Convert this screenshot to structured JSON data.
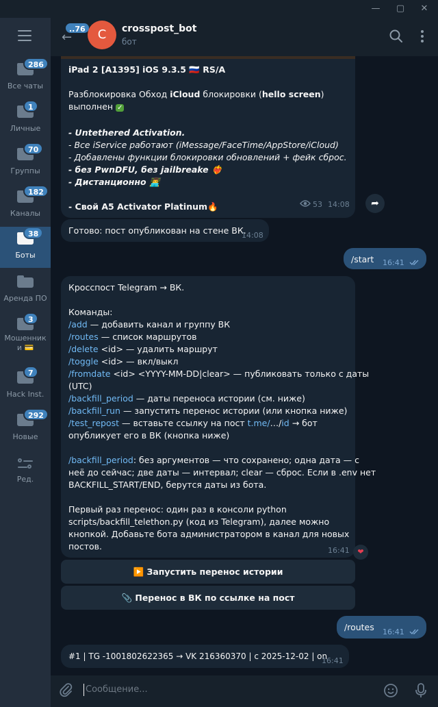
{
  "window": {
    "minimize": "—",
    "maximize": "▢",
    "close": "✕"
  },
  "sidebar": {
    "folders": [
      {
        "label": "Все чаты",
        "badge": "286"
      },
      {
        "label": "Личные",
        "badge": "1"
      },
      {
        "label": "Группы",
        "badge": "70"
      },
      {
        "label": "Каналы",
        "badge": "182"
      },
      {
        "label": "Боты",
        "badge": "38"
      },
      {
        "label": "Аренда ПО",
        "badge": ""
      },
      {
        "label": "Мошенник и 💳",
        "badge": "3"
      },
      {
        "label": "Hack Inst.",
        "badge": "7"
      },
      {
        "label": "Новые",
        "badge": "292"
      }
    ],
    "edit_label": "Ред."
  },
  "header": {
    "unread": "..76",
    "avatar_letter": "C",
    "title": "crosspost_bot",
    "status": "бот"
  },
  "messages": {
    "post": {
      "line1": "iPad 2 [A1395] iOS 9.3.5 🇷🇺 RS/A",
      "line2a": "Разблокировка Обход ",
      "line2b": "iCloud",
      "line2c": " блокировки (",
      "line2d": "hello screen",
      "line2e": ")",
      "line3": "выполнен",
      "line3_check": "✓",
      "line4": "- Untethered Activation.",
      "line5": "- Все iService работают (iMessage/FaceTime/AppStore/iCloud)",
      "line6": "- Добавлены функции блокировки обновлений + фейк сброс.",
      "line7": "- без PwnDFU, без jailbreake ❤️‍🔥",
      "line8": "- Дистанционно 👨‍💻",
      "line9": "- Свой A5 Activator Platinum🔥",
      "views": "53",
      "time": "14:08"
    },
    "published": {
      "text": "Готово: пост опубликован на стене ВК.",
      "time": "14:08"
    },
    "start_cmd": {
      "text": "/start",
      "time": "16:41"
    },
    "help": {
      "l1": "Кросспост Telegram → ВК.",
      "l2": "Команды:",
      "l3_cmd": "/add",
      "l3_rest": " — добавить канал и группу ВК",
      "l4_cmd": "/routes",
      "l4_rest": " — список маршрутов",
      "l5_cmd": "/delete",
      "l5_rest": " <id> — удалить маршрут",
      "l6_cmd": "/toggle",
      "l6_rest": " <id> — вкл/выкл",
      "l7_cmd": "/fromdate",
      "l7_rest": " <id> <YYYY-MM-DD|clear> — публиковать только с даты",
      "l7b": "(UTC)",
      "l8_cmd": "/backfill_period",
      "l8_rest": " — даты переноса истории (см. ниже)",
      "l9_cmd": "/backfill_run",
      "l9_rest": " — запустить перенос истории (или кнопка ниже)",
      "l10_cmd": "/test_repost",
      "l10_mid": " — вставьте ссылку на пост ",
      "l10_link": "t.me/",
      "l10_mid2": "…/",
      "l10_link2": "id",
      "l10_rest": " → бот",
      "l10b": "опубликует его в ВК (кнопка ниже)",
      "l11_cmd": "/backfill_period",
      "l11_rest": ": без аргументов — что сохранено; одна дата — с",
      "l11b": "неё до сейчас; две даты — интервал; clear — сброс. Если в .env нет",
      "l11c": "BACKFILL_START/END, берутся даты из бота.",
      "l12": "Первый раз перенос: один раз в консоли python",
      "l12b": "scripts/backfill_telethon.py (код из Telegram), далее можно",
      "l12c": "кнопкой. Добавьте бота администратором в канал для новых",
      "l12d": "постов.",
      "time": "16:41",
      "reaction": "❤"
    },
    "buttons": {
      "run": "▶️ Запустить перенос истории",
      "repost": "📎 Перенос в ВК по ссылке на пост"
    },
    "routes_cmd": {
      "text": "/routes",
      "time": "16:41"
    },
    "routes_result": {
      "text": "#1 | TG -1001802622365 → VK 216360370 | с 2025-12-02 | on",
      "time": "16:41"
    }
  },
  "composer": {
    "placeholder": "Сообщение..."
  }
}
